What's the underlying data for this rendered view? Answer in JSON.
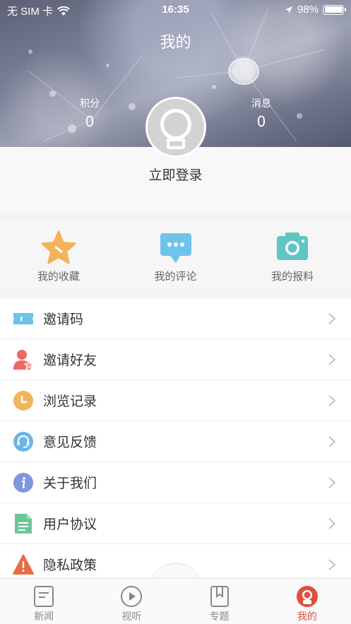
{
  "status_bar": {
    "carrier": "无 SIM 卡",
    "time": "16:35",
    "battery": "98%"
  },
  "header": {
    "title": "我的",
    "points_label": "积分",
    "points_value": "0",
    "messages_label": "消息",
    "messages_value": "0"
  },
  "login": {
    "label": "立即登录"
  },
  "quick_actions": [
    {
      "label": "我的收藏",
      "icon": "star-icon",
      "color": "#f3b35c"
    },
    {
      "label": "我的评论",
      "icon": "comment-icon",
      "color": "#6ec3ea"
    },
    {
      "label": "我的报料",
      "icon": "camera-icon",
      "color": "#5fc6c4"
    }
  ],
  "menu": [
    {
      "label": "邀请码",
      "icon": "ticket-icon",
      "color": "#6cc3e6"
    },
    {
      "label": "邀请好友",
      "icon": "user-star-icon",
      "color": "#ec6a60"
    },
    {
      "label": "浏览记录",
      "icon": "clock-icon",
      "color": "#f0b45a"
    },
    {
      "label": "意见反馈",
      "icon": "headset-icon",
      "color": "#6cb4ea"
    },
    {
      "label": "关于我们",
      "icon": "info-icon",
      "color": "#7f95e0"
    },
    {
      "label": "用户协议",
      "icon": "document-icon",
      "color": "#6cc796"
    },
    {
      "label": "隐私政策",
      "icon": "warning-icon",
      "color": "#e86c44"
    }
  ],
  "tabs": [
    {
      "label": "新闻",
      "icon": "news-icon"
    },
    {
      "label": "视听",
      "icon": "play-icon"
    },
    {
      "label": "专题",
      "icon": "bookmark-icon"
    },
    {
      "label": "我的",
      "icon": "profile-icon",
      "active": true
    }
  ],
  "colors": {
    "accent": "#e0503c",
    "tab_inactive": "#888888"
  }
}
